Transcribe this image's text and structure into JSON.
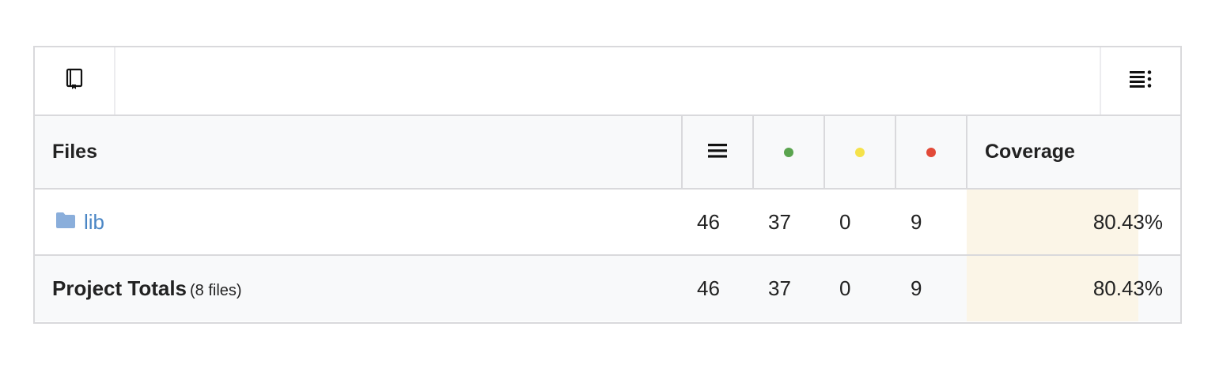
{
  "toolbar": {
    "left_icon": "book-icon",
    "right_icon": "list-settings-icon"
  },
  "table": {
    "columns": {
      "files": "Files",
      "lines_icon": "lines-icon",
      "hit_icon": "green-dot-icon",
      "partial_icon": "yellow-dot-icon",
      "miss_icon": "red-dot-icon",
      "coverage": "Coverage"
    },
    "colors": {
      "hit": "#5aa44e",
      "partial": "#f5e24a",
      "miss": "#e24a38",
      "link": "#4a86c5",
      "folder": "#8aaedb",
      "coverage_bar": "#fbf5e7"
    },
    "rows": [
      {
        "name": "lib",
        "icon": "folder-icon",
        "lines": "46",
        "hit": "37",
        "partial": "0",
        "miss": "9",
        "coverage": "80.43%",
        "coverage_fraction": 0.8043
      }
    ],
    "totals": {
      "label": "Project Totals",
      "sub": "(8 files)",
      "lines": "46",
      "hit": "37",
      "partial": "0",
      "miss": "9",
      "coverage": "80.43%",
      "coverage_fraction": 0.8043
    }
  }
}
